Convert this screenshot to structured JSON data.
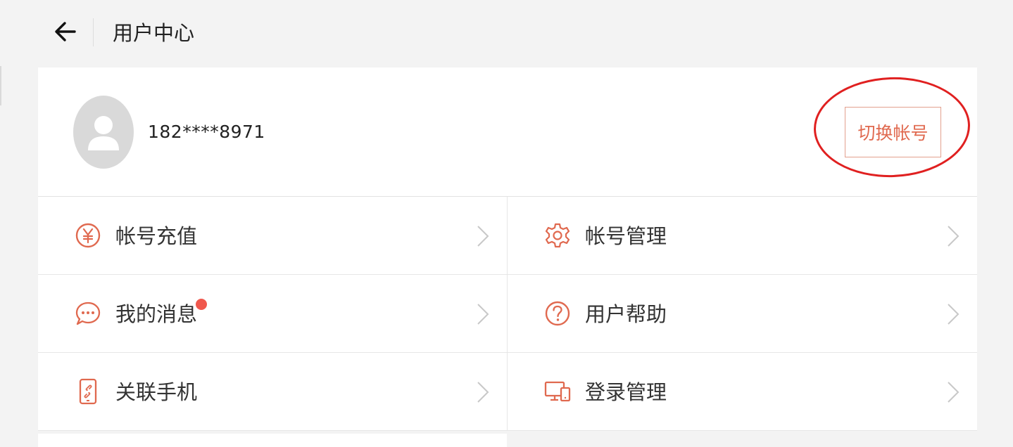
{
  "header": {
    "title": "用户中心",
    "back_icon": "arrow-left-icon"
  },
  "profile": {
    "phone": "182****8971",
    "avatar_icon": "user-avatar-icon",
    "switch_label": "切换帐号"
  },
  "menu": [
    {
      "label": "帐号充值",
      "icon": "yuan-icon"
    },
    {
      "label": "帐号管理",
      "icon": "gear-icon"
    },
    {
      "label": "我的消息",
      "icon": "chat-bubble-icon",
      "has_badge": true
    },
    {
      "label": "用户帮助",
      "icon": "question-icon"
    },
    {
      "label": "关联手机",
      "icon": "phone-link-icon"
    },
    {
      "label": "登录管理",
      "icon": "devices-icon"
    }
  ],
  "colors": {
    "accent": "#e0694f",
    "annotation": "#e02020",
    "badge": "#f0584d"
  }
}
